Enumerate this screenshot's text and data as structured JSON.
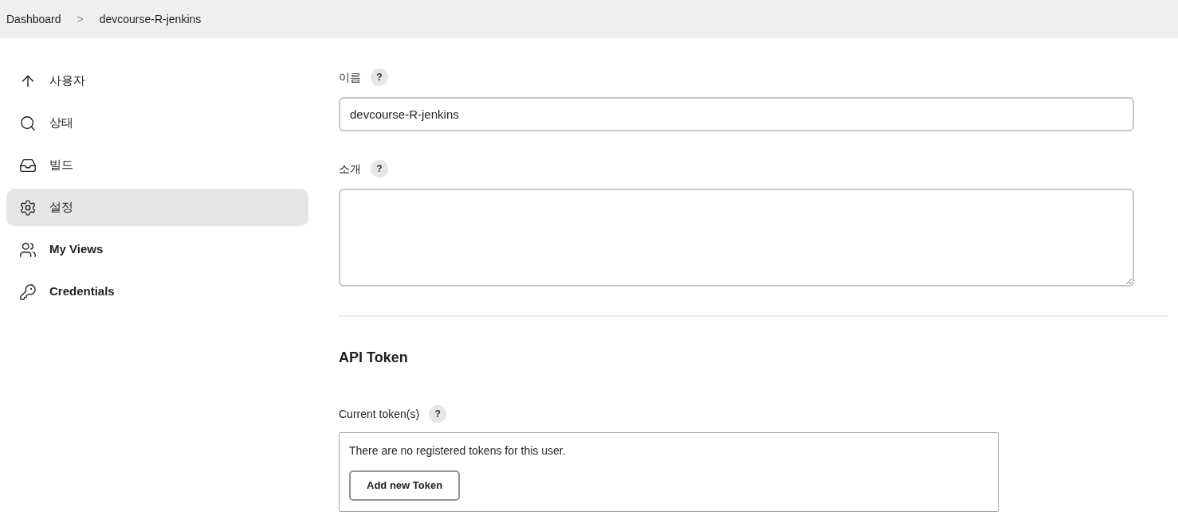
{
  "breadcrumb": {
    "items": [
      "Dashboard",
      "devcourse-R-jenkins"
    ],
    "separator": ">"
  },
  "sidebar": {
    "items": [
      {
        "label": "사용자",
        "selected": false
      },
      {
        "label": "상태",
        "selected": false
      },
      {
        "label": "빌드",
        "selected": false
      },
      {
        "label": "설정",
        "selected": true
      },
      {
        "label": "My Views",
        "selected": false
      },
      {
        "label": "Credentials",
        "selected": false
      }
    ]
  },
  "form": {
    "name": {
      "label": "이름",
      "help": "?",
      "value": "devcourse-R-jenkins"
    },
    "description": {
      "label": "소개",
      "help": "?"
    }
  },
  "api_token": {
    "heading": "API Token",
    "label": "Current token(s)",
    "help": "?",
    "empty_text": "There are no registered tokens for this user.",
    "button": "Add new Token"
  }
}
